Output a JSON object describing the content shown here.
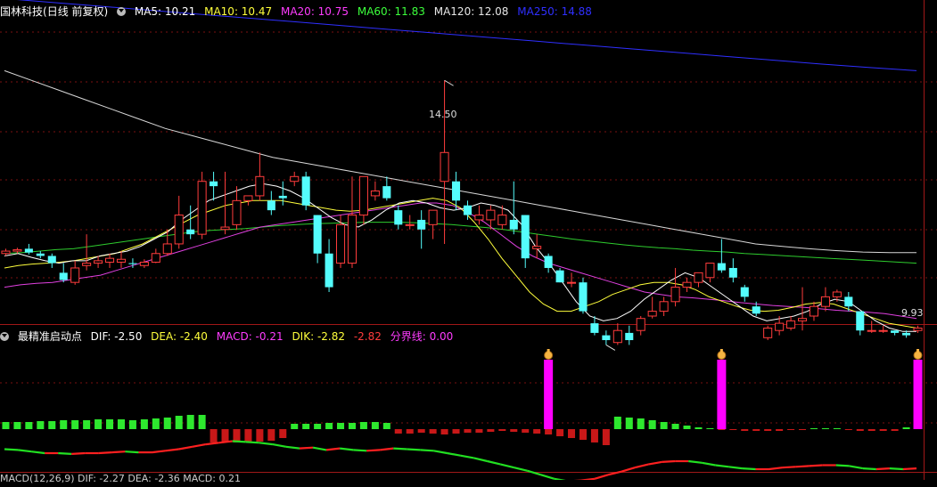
{
  "stock_name": "国林科技",
  "period_label": "(日线 前复权)",
  "ma_labels": [
    {
      "text": "MA5: 10.21",
      "color": "#ffffff"
    },
    {
      "text": "MA10: 10.47",
      "color": "#ffff3c"
    },
    {
      "text": "MA20: 10.75",
      "color": "#ff3cff"
    },
    {
      "text": "MA60: 11.83",
      "color": "#3cff3c"
    },
    {
      "text": "MA120: 12.08",
      "color": "#e6e6e6"
    },
    {
      "text": "MA250: 14.88",
      "color": "#2f2fff"
    }
  ],
  "high_label": "14.50",
  "low_label": "9.93",
  "indicator": {
    "name": "最精准启动点",
    "values": [
      {
        "text": "DIF: -2.50",
        "color": "#ffffff"
      },
      {
        "text": "DEA: -2.40",
        "color": "#ffff3c"
      },
      {
        "text": "MACD: -0.21",
        "color": "#ff3cff"
      },
      {
        "text": "DIK: -2.82",
        "color": "#ffff3c"
      },
      {
        "text": "-2.82",
        "color": "#ff3c3c"
      },
      {
        "text": "分界线: 0.00",
        "color": "#ff3cff"
      }
    ]
  },
  "bottom_stub": "MACD(12,26,9) DIF: -2.27 DEA: -2.36 MACD: 0.21",
  "colors": {
    "up": "#ff3c3c",
    "down": "#54fcfc",
    "grid": "#7a1010",
    "border": "#a01818",
    "signal": "#ff00ff"
  },
  "chart_data": {
    "type": "candlestick",
    "y_range": [
      9.6,
      15.8
    ],
    "candles": [
      [
        10.9,
        10.95,
        10.85,
        11.0
      ],
      [
        10.95,
        10.98,
        10.9,
        11.02
      ],
      [
        11.0,
        10.92,
        10.88,
        11.1
      ],
      [
        10.9,
        10.85,
        10.8,
        10.95
      ],
      [
        10.85,
        10.7,
        10.6,
        10.9
      ],
      [
        10.5,
        10.35,
        10.3,
        10.7
      ],
      [
        10.3,
        10.6,
        10.25,
        10.75
      ],
      [
        10.65,
        10.7,
        10.55,
        11.3
      ],
      [
        10.7,
        10.75,
        10.6,
        10.85
      ],
      [
        10.72,
        10.8,
        10.6,
        10.9
      ],
      [
        10.72,
        10.78,
        10.6,
        10.95
      ],
      [
        10.7,
        10.68,
        10.6,
        10.8
      ],
      [
        10.65,
        10.72,
        10.6,
        10.78
      ],
      [
        10.72,
        10.9,
        10.7,
        11.0
      ],
      [
        10.9,
        11.1,
        10.85,
        11.4
      ],
      [
        11.1,
        11.7,
        11.0,
        12.1
      ],
      [
        11.4,
        11.3,
        11.2,
        11.9
      ],
      [
        11.3,
        12.4,
        11.2,
        12.6
      ],
      [
        12.4,
        12.3,
        12.0,
        12.6
      ],
      [
        11.4,
        11.45,
        11.3,
        12.6
      ],
      [
        11.5,
        12.0,
        11.4,
        12.3
      ],
      [
        12.0,
        12.1,
        11.9,
        12.1
      ],
      [
        12.1,
        12.5,
        12.0,
        13.0
      ],
      [
        12.0,
        11.8,
        11.7,
        12.2
      ],
      [
        12.1,
        12.05,
        11.9,
        12.4
      ],
      [
        12.4,
        12.5,
        12.3,
        12.6
      ],
      [
        12.5,
        11.9,
        11.8,
        12.6
      ],
      [
        11.7,
        10.9,
        10.7,
        11.7
      ],
      [
        10.9,
        10.2,
        10.1,
        11.2
      ],
      [
        10.7,
        11.5,
        10.6,
        11.7
      ],
      [
        10.7,
        11.7,
        10.6,
        12.5
      ],
      [
        11.7,
        12.5,
        11.5,
        12.5
      ],
      [
        12.1,
        12.2,
        12.0,
        12.4
      ],
      [
        12.3,
        12.05,
        12.0,
        12.5
      ],
      [
        11.8,
        11.5,
        11.4,
        11.9
      ],
      [
        11.5,
        11.5,
        11.4,
        11.7
      ],
      [
        11.6,
        11.4,
        11.0,
        11.8
      ],
      [
        11.5,
        11.8,
        11.2,
        11.8
      ],
      [
        12.4,
        13.0,
        11.1,
        14.5
      ],
      [
        12.4,
        12.0,
        11.8,
        12.6
      ],
      [
        11.9,
        11.7,
        11.6,
        12.0
      ],
      [
        11.6,
        11.7,
        11.5,
        11.9
      ],
      [
        11.6,
        11.8,
        11.4,
        11.9
      ],
      [
        11.5,
        11.7,
        11.4,
        11.9
      ],
      [
        11.6,
        11.4,
        11.3,
        12.4
      ],
      [
        11.7,
        10.8,
        10.6,
        11.7
      ],
      [
        11.0,
        11.05,
        10.8,
        11.3
      ],
      [
        10.85,
        10.6,
        10.5,
        10.9
      ],
      [
        10.55,
        10.3,
        10.3,
        10.6
      ],
      [
        10.3,
        10.3,
        10.2,
        10.5
      ],
      [
        10.3,
        9.7,
        9.65,
        10.4
      ],
      [
        9.45,
        9.25,
        9.2,
        9.6
      ],
      [
        9.2,
        9.1,
        9.0,
        9.3
      ],
      [
        9.05,
        9.3,
        9.0,
        9.45
      ],
      [
        9.25,
        9.1,
        9.0,
        9.4
      ],
      [
        9.3,
        9.55,
        9.2,
        9.6
      ],
      [
        9.6,
        9.7,
        9.55,
        10.0
      ],
      [
        9.7,
        9.9,
        9.6,
        10.0
      ],
      [
        9.9,
        10.2,
        9.8,
        10.6
      ],
      [
        10.2,
        10.3,
        10.1,
        10.4
      ],
      [
        10.3,
        10.5,
        10.2,
        10.5
      ],
      [
        10.4,
        10.7,
        10.3,
        10.5
      ],
      [
        10.7,
        10.55,
        10.5,
        11.2
      ],
      [
        10.6,
        10.4,
        10.3,
        10.8
      ],
      [
        10.2,
        10.0,
        9.9,
        10.25
      ],
      [
        9.8,
        9.65,
        9.6,
        9.9
      ],
      [
        9.15,
        9.35,
        9.1,
        9.4
      ],
      [
        9.3,
        9.45,
        9.2,
        9.6
      ],
      [
        9.35,
        9.5,
        9.3,
        9.6
      ],
      [
        9.5,
        9.55,
        9.3,
        10.2
      ],
      [
        9.6,
        9.8,
        9.5,
        9.9
      ],
      [
        9.8,
        10.0,
        9.7,
        10.2
      ],
      [
        10.0,
        10.1,
        9.9,
        10.15
      ],
      [
        10.0,
        9.8,
        9.7,
        10.1
      ],
      [
        9.7,
        9.3,
        9.2,
        9.7
      ],
      [
        9.3,
        9.3,
        9.25,
        9.5
      ],
      [
        9.3,
        9.3,
        9.25,
        9.4
      ],
      [
        9.3,
        9.25,
        9.2,
        9.3
      ],
      [
        9.25,
        9.2,
        9.15,
        9.3
      ],
      [
        9.3,
        9.35,
        9.25,
        9.4
      ]
    ],
    "ma5": [
      10.85,
      10.9,
      10.82,
      10.75,
      10.7,
      10.75,
      10.75,
      10.85,
      10.9,
      10.95,
      11.05,
      11.2,
      11.35,
      11.6,
      11.8,
      12.0,
      12.1,
      12.2,
      12.3,
      12.35,
      12.3,
      12.2,
      12.05,
      11.85,
      11.65,
      11.5,
      11.45,
      11.6,
      11.8,
      11.95,
      12.0,
      11.95,
      11.85,
      11.8,
      11.85,
      11.95,
      11.9,
      11.8,
      11.5,
      11.05,
      10.7,
      10.3,
      9.9,
      9.6,
      9.5,
      9.55,
      9.7,
      9.95,
      10.15,
      10.35,
      10.5,
      10.4,
      10.2,
      10.0,
      9.8,
      9.6,
      9.5,
      9.55,
      9.6,
      9.7,
      9.85,
      9.95,
      9.9,
      9.7,
      9.5,
      9.35,
      9.28,
      9.28
    ],
    "ma10": [
      10.6,
      10.65,
      10.68,
      10.7,
      10.72,
      10.75,
      10.8,
      10.85,
      10.9,
      11.0,
      11.1,
      11.25,
      11.4,
      11.55,
      11.7,
      11.8,
      11.9,
      11.95,
      12.0,
      12.0,
      12.0,
      11.95,
      11.9,
      11.85,
      11.8,
      11.78,
      11.8,
      11.85,
      11.9,
      11.95,
      12.0,
      12.05,
      12.0,
      11.85,
      11.55,
      11.2,
      10.8,
      10.45,
      10.1,
      9.85,
      9.7,
      9.7,
      9.8,
      9.9,
      10.05,
      10.15,
      10.25,
      10.3,
      10.3,
      10.25,
      10.15,
      10.0,
      9.9,
      9.8,
      9.72,
      9.7,
      9.72,
      9.78,
      9.85,
      9.88,
      9.85,
      9.75,
      9.65,
      9.55,
      9.45,
      9.4,
      9.35
    ],
    "ma20": [
      10.2,
      10.25,
      10.28,
      10.3,
      10.35,
      10.4,
      10.45,
      10.55,
      10.65,
      10.75,
      10.85,
      10.95,
      11.05,
      11.15,
      11.25,
      11.35,
      11.45,
      11.5,
      11.55,
      11.6,
      11.65,
      11.7,
      11.75,
      11.8,
      11.85,
      11.9,
      11.95,
      11.95,
      11.9,
      11.75,
      11.55,
      11.3,
      11.05,
      10.85,
      10.7,
      10.6,
      10.5,
      10.4,
      10.3,
      10.2,
      10.1,
      10.05,
      10.0,
      9.98,
      9.95,
      9.92,
      9.88,
      9.85,
      9.82,
      9.8,
      9.78,
      9.75,
      9.72,
      9.7,
      9.68,
      9.65,
      9.6,
      9.55
    ],
    "ma60": [
      10.9,
      10.92,
      10.95,
      10.98,
      11.0,
      11.05,
      11.1,
      11.15,
      11.2,
      11.25,
      11.3,
      11.35,
      11.38,
      11.4,
      11.42,
      11.45,
      11.48,
      11.5,
      11.52,
      11.53,
      11.54,
      11.55,
      11.55,
      11.55,
      11.54,
      11.52,
      11.5,
      11.47,
      11.44,
      11.4,
      11.35,
      11.3,
      11.25,
      11.2,
      11.16,
      11.12,
      11.08,
      11.05,
      11.02,
      11.0,
      10.97,
      10.95,
      10.93,
      10.9,
      10.88,
      10.86,
      10.84,
      10.82,
      10.8,
      10.78,
      10.76,
      10.74,
      10.72,
      10.7
    ],
    "ma120": [
      14.7,
      14.5,
      14.3,
      14.1,
      13.9,
      13.7,
      13.5,
      13.35,
      13.2,
      13.05,
      12.9,
      12.8,
      12.7,
      12.6,
      12.5,
      12.4,
      12.3,
      12.2,
      12.1,
      12.0,
      11.9,
      11.8,
      11.7,
      11.6,
      11.5,
      11.4,
      11.3,
      11.2,
      11.1,
      11.05,
      11.0,
      10.96,
      10.93,
      10.92,
      10.92
    ],
    "ma250": [
      16.2,
      16.12,
      16.04,
      15.96,
      15.88,
      15.8,
      15.72,
      15.64,
      15.56,
      15.48,
      15.4,
      15.32,
      15.24,
      15.16,
      15.08,
      15.0,
      14.92,
      14.84,
      14.77,
      14.7
    ],
    "histogram": [
      0.08,
      0.08,
      0.08,
      0.09,
      0.09,
      0.1,
      0.1,
      0.1,
      0.11,
      0.11,
      0.11,
      0.1,
      0.11,
      0.12,
      0.13,
      0.15,
      0.16,
      0.16,
      -0.15,
      -0.15,
      -0.15,
      -0.14,
      -0.14,
      -0.13,
      -0.1,
      0.06,
      0.06,
      0.06,
      0.07,
      0.07,
      0.07,
      0.08,
      0.08,
      0.07,
      -0.05,
      -0.05,
      -0.04,
      -0.05,
      -0.06,
      -0.05,
      -0.04,
      -0.04,
      -0.03,
      -0.02,
      -0.03,
      -0.04,
      -0.05,
      -0.06,
      -0.08,
      -0.1,
      -0.12,
      -0.15,
      -0.18,
      0.14,
      0.13,
      0.12,
      0.1,
      0.08,
      0.06,
      0.04,
      0.02,
      0.01,
      -0.01,
      -0.01,
      -0.02,
      -0.02,
      -0.02,
      -0.02,
      -0.01,
      -0.01,
      0.01,
      0.01,
      0.01,
      -0.01,
      -0.02,
      -0.02,
      -0.02,
      -0.02,
      0.02,
      0.03
    ],
    "signal_bars": [
      47,
      62,
      79
    ],
    "dif_line": [
      -0.05,
      -0.06,
      -0.08,
      -0.1,
      -0.1,
      -0.11,
      -0.1,
      -0.1,
      -0.09,
      -0.08,
      -0.09,
      -0.09,
      -0.07,
      -0.05,
      -0.02,
      0.01,
      0.03,
      0.05,
      0.04,
      0.03,
      0.01,
      -0.02,
      -0.04,
      -0.03,
      -0.06,
      -0.04,
      -0.06,
      -0.07,
      -0.06,
      -0.04,
      -0.05,
      -0.06,
      -0.07,
      -0.1,
      -0.13,
      -0.16,
      -0.2,
      -0.24,
      -0.28,
      -0.32,
      -0.37,
      -0.42,
      -0.45,
      -0.44,
      -0.42,
      -0.37,
      -0.33,
      -0.28,
      -0.24,
      -0.21,
      -0.2,
      -0.2,
      -0.22,
      -0.25,
      -0.27,
      -0.29,
      -0.3,
      -0.3,
      -0.28,
      -0.27,
      -0.26,
      -0.25,
      -0.25,
      -0.26,
      -0.29,
      -0.3,
      -0.29,
      -0.3,
      -0.29
    ]
  }
}
